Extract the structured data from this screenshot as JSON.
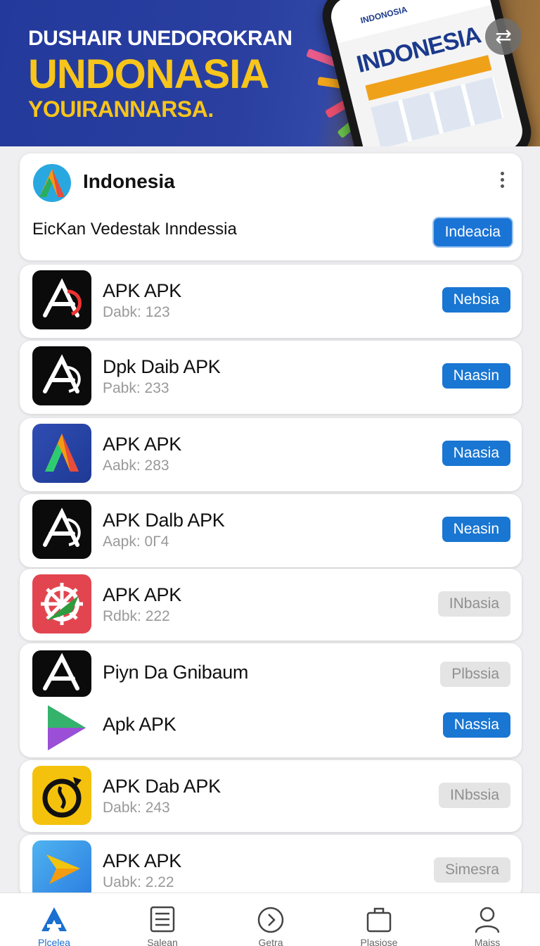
{
  "banner": {
    "line1": "DUSHAIR UNEDOROKRAN",
    "line2": "UNDONASIA",
    "line3": "YOUIRANNARSA.",
    "phone_title": "INDONESIA",
    "phone_brand": "INDONOSIA"
  },
  "header_card": {
    "title": "Indonesia",
    "subtitle": "EicKan Vedestak Inndessia",
    "button": "Indeacia"
  },
  "apps": [
    {
      "name": "APK APK",
      "meta": "Dabk: 123",
      "button": "Nebsia",
      "style": "primary",
      "icon": "black-stylized-a-icon"
    },
    {
      "name": "Dpk Daib APK",
      "meta": "Pabk: 233",
      "button": "Naasin",
      "style": "primary",
      "icon": "black-stylized-a-icon"
    },
    {
      "name": "APK APK",
      "meta": "Aabk: 283",
      "button": "Naasia",
      "style": "primary",
      "icon": "blue-gradient-a-icon"
    },
    {
      "name": "APK Dalb APK",
      "meta": "Aapk: 0Г4",
      "button": "Neasin",
      "style": "primary",
      "icon": "black-stylized-a-icon"
    },
    {
      "name": "APK APK",
      "meta": "Rdbk: 222",
      "button": "INbasia",
      "style": "disabled",
      "icon": "red-wheel-arrow-icon"
    },
    {
      "name": "Piyn Da Gnibaum",
      "meta": "",
      "button": "Plbssia",
      "style": "disabled",
      "icon": "black-stylized-a-icon"
    },
    {
      "name": "Apk APK",
      "meta": "",
      "button": "Nassia",
      "style": "primary",
      "icon": "play-triangle-icon"
    },
    {
      "name": "APK Dab APK",
      "meta": "Dabk: 243",
      "button": "INbssia",
      "style": "disabled",
      "icon": "yellow-clock-icon"
    },
    {
      "name": "APK APK",
      "meta": "Uabk: 2.22",
      "button": "Simesra",
      "style": "disabled",
      "icon": "blue-arrow-icon"
    }
  ],
  "tabs": [
    {
      "label": "Plcelea",
      "icon": "home-a-icon",
      "active": true
    },
    {
      "label": "Salean",
      "icon": "list-icon",
      "active": false
    },
    {
      "label": "Getra",
      "icon": "chevron-circle-icon",
      "active": false
    },
    {
      "label": "Plasiose",
      "icon": "briefcase-icon",
      "active": false
    },
    {
      "label": "Maiss",
      "icon": "person-icon",
      "active": false
    }
  ],
  "colors": {
    "primary": "#1976d2",
    "banner": "#233a9c",
    "banner_accent": "#f7c51b",
    "disabled": "#e4e4e4"
  }
}
